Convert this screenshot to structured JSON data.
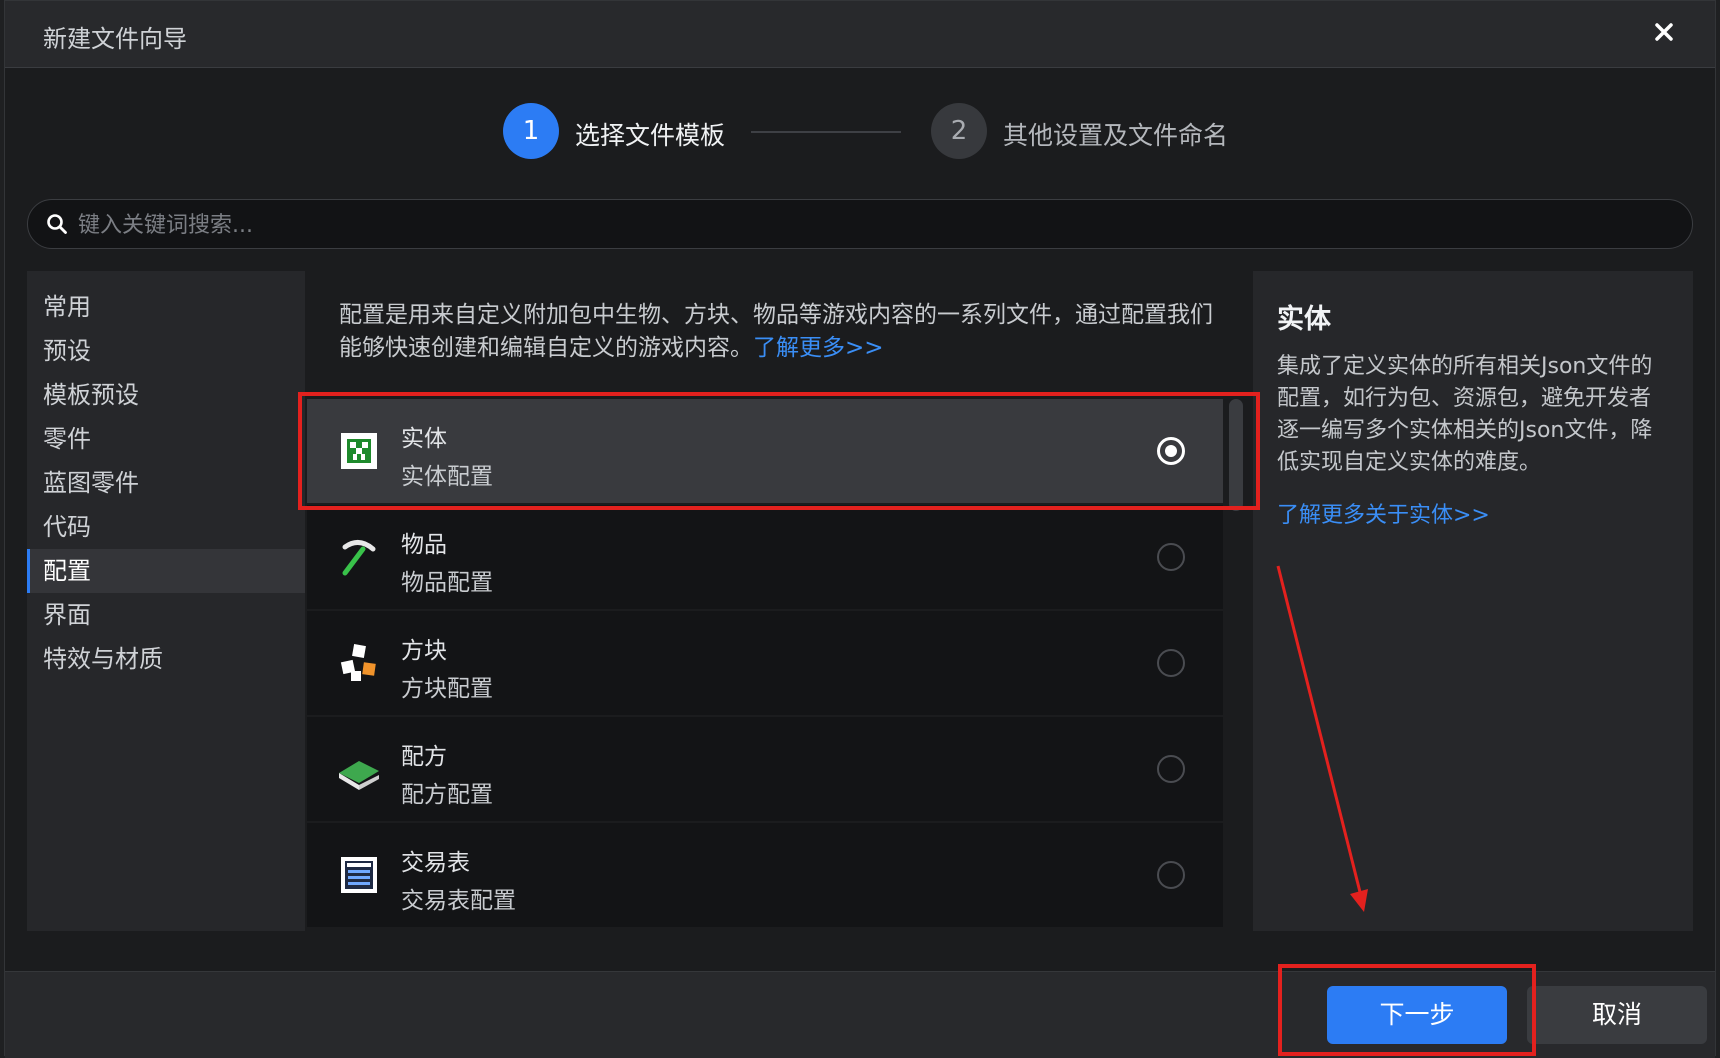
{
  "window": {
    "title": "新建文件向导",
    "close_icon": "close-icon"
  },
  "steps": [
    {
      "number": "1",
      "label": "选择文件模板",
      "state": "active"
    },
    {
      "number": "2",
      "label": "其他设置及文件命名",
      "state": "inactive"
    }
  ],
  "search": {
    "placeholder": "键入关键词搜索...",
    "value": "",
    "icon": "search-icon"
  },
  "sidebar": {
    "items": [
      {
        "label": "常用"
      },
      {
        "label": "预设"
      },
      {
        "label": "模板预设"
      },
      {
        "label": "零件"
      },
      {
        "label": "蓝图零件"
      },
      {
        "label": "代码"
      },
      {
        "label": "配置",
        "active": true
      },
      {
        "label": "界面"
      },
      {
        "label": "特效与材质"
      }
    ]
  },
  "main": {
    "description": "配置是用来自定义附加包中生物、方块、物品等游戏内容的一系列文件，通过配置我们能够快速创建和编辑自定义的游戏内容。",
    "learn_more": "了解更多>>",
    "templates": [
      {
        "title": "实体",
        "subtitle": "实体配置",
        "icon": "entity-creeper-icon",
        "selected": true
      },
      {
        "title": "物品",
        "subtitle": "物品配置",
        "icon": "pickaxe-icon",
        "selected": false
      },
      {
        "title": "方块",
        "subtitle": "方块配置",
        "icon": "blocks-icon",
        "selected": false
      },
      {
        "title": "配方",
        "subtitle": "配方配置",
        "icon": "recipe-book-icon",
        "selected": false
      },
      {
        "title": "交易表",
        "subtitle": "交易表配置",
        "icon": "trade-table-icon",
        "selected": false
      }
    ]
  },
  "detail": {
    "title": "实体",
    "description": "集成了定义实体的所有相关Json文件的配置，如行为包、资源包，避免开发者逐一编写多个实体相关的Json文件，降低实现自定义实体的难度。",
    "learn_more": "了解更多关于实体>>"
  },
  "footer": {
    "next_label": "下一步",
    "cancel_label": "取消"
  },
  "colors": {
    "accent": "#2c7cf4",
    "link": "#3a8ef6",
    "annotation": "#e3211e"
  }
}
